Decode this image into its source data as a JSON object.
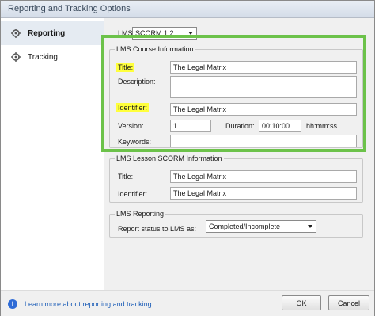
{
  "window": {
    "title": "Reporting and Tracking Options"
  },
  "sidebar": {
    "items": [
      {
        "label": "Reporting",
        "icon": "gear-icon",
        "active": true
      },
      {
        "label": "Tracking",
        "icon": "gear-icon",
        "active": false
      }
    ]
  },
  "lms": {
    "label": "LMS:",
    "selected": "SCORM 1.2"
  },
  "course_info": {
    "title": "LMS Course Information",
    "title_label": "Title:",
    "title_value": "The Legal Matrix",
    "description_label": "Description:",
    "description_value": "",
    "identifier_label": "Identifier:",
    "identifier_value": "The Legal Matrix",
    "version_label": "Version:",
    "version_value": "1",
    "duration_label": "Duration:",
    "duration_value": "00:10:00",
    "duration_format": "hh:mm:ss",
    "keywords_label": "Keywords:",
    "keywords_value": ""
  },
  "lesson_info": {
    "title": "LMS Lesson SCORM Information",
    "title_label": "Title:",
    "title_value": "The Legal Matrix",
    "identifier_label": "Identifier:",
    "identifier_value": "The Legal Matrix"
  },
  "reporting": {
    "title": "LMS Reporting",
    "status_label": "Report status to LMS as:",
    "status_selected": "Completed/Incomplete"
  },
  "footer": {
    "link": "Learn more about reporting and tracking",
    "ok": "OK",
    "cancel": "Cancel"
  },
  "colors": {
    "highlight": "#ffff3c",
    "green_outline": "#6cc24a",
    "link": "#1f5fb8"
  }
}
